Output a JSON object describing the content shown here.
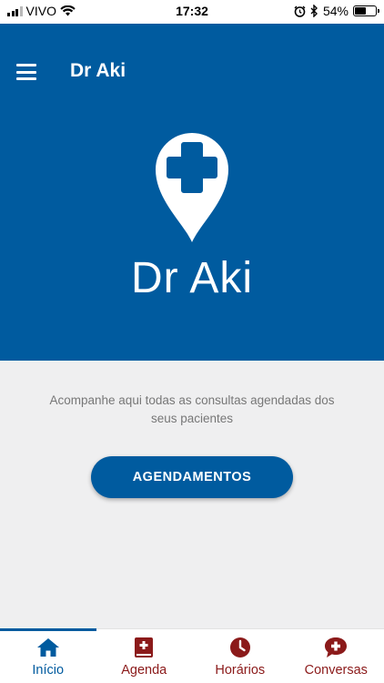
{
  "status_bar": {
    "carrier": "VIVO",
    "time": "17:32",
    "battery_percent": "54%",
    "icons": [
      "signal-icon",
      "wifi-icon",
      "alarm-icon",
      "bluetooth-icon",
      "battery-icon"
    ]
  },
  "app_bar": {
    "title": "Dr Aki",
    "menu_icon": "hamburger-menu-icon"
  },
  "hero": {
    "logo_icon": "location-pin-medical-cross-icon",
    "brand_name": "Dr Aki"
  },
  "main": {
    "intro_text": "Acompanhe aqui todas as consultas agendadas dos seus pacientes",
    "cta_label": "AGENDAMENTOS"
  },
  "bottom_nav": {
    "items": [
      {
        "label": "Início",
        "icon": "home-icon",
        "active": true
      },
      {
        "label": "Agenda",
        "icon": "medical-book-icon",
        "active": false
      },
      {
        "label": "Horários",
        "icon": "clock-icon",
        "active": false
      },
      {
        "label": "Conversas",
        "icon": "chat-medical-icon",
        "active": false
      }
    ]
  },
  "colors": {
    "primary": "#005b9f",
    "accent_inactive": "#8b1a1a",
    "background": "#efeff0",
    "text_muted": "#777777"
  }
}
